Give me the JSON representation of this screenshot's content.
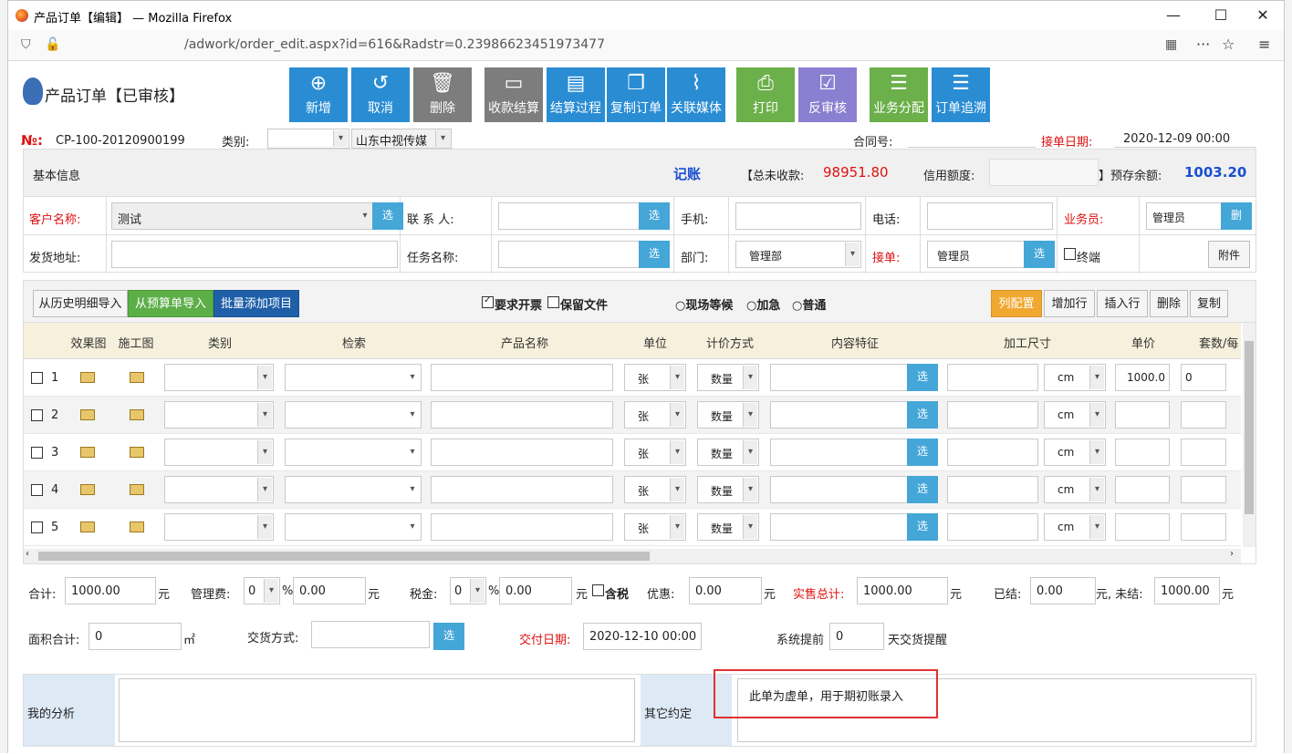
{
  "window": {
    "title": "产品订单【编辑】 — Mozilla Firefox",
    "url": "/adwork/order_edit.aspx?id=616&Radstr=0.23986623451973477"
  },
  "header": {
    "page_title": "产品订单【已审核】"
  },
  "toolbar": [
    {
      "label": "新增",
      "icon": "plus-circle-icon"
    },
    {
      "label": "取消",
      "icon": "undo-icon"
    },
    {
      "label": "删除",
      "icon": "trash-icon"
    },
    {
      "label": "收款结算",
      "icon": "money-icon"
    },
    {
      "label": "结算过程",
      "icon": "document-icon"
    },
    {
      "label": "复制订单",
      "icon": "copy-icon"
    },
    {
      "label": "关联媒体",
      "icon": "paperclip-icon"
    },
    {
      "label": "打印",
      "icon": "printer-icon"
    },
    {
      "label": "反审核",
      "icon": "check-square-icon"
    },
    {
      "label": "业务分配",
      "icon": "list-icon"
    },
    {
      "label": "订单追溯",
      "icon": "list-icon"
    }
  ],
  "order": {
    "no_label": "№:",
    "no": "CP-100-20120900199",
    "type_label": "类别:",
    "type_value": "",
    "company": "山东中视传媒",
    "contract_label": "合同号:",
    "contract_value": "",
    "order_date_label": "接单日期:",
    "order_date": "2020-12-09 00:00"
  },
  "info": {
    "title": "基本信息",
    "bookkeep": "记账",
    "unpaid_label": "【总未收款:",
    "unpaid": "98951.80",
    "credit_label": "信用额度:",
    "credit": "",
    "prepay_label": "】预存余额:",
    "prepay": "1003.20",
    "customer_label": "客户名称:",
    "customer": "测试",
    "contact_label": "联 系 人:",
    "contact": "",
    "mobile_label": "手机:",
    "mobile": "",
    "phone_label": "电话:",
    "phone": "",
    "salesman_label": "业务员:",
    "salesman": "管理员",
    "address_label": "发货地址:",
    "address": "",
    "task_label": "任务名称:",
    "task": "",
    "dept_label": "部门:",
    "dept": "管理部",
    "receiver_label": "接单:",
    "receiver": "管理员",
    "terminal_label": "终端",
    "attach_label": "附件",
    "pick": "选",
    "del": "删"
  },
  "items_bar": {
    "import_history": "从历史明细导入",
    "import_budget": "从预算单导入",
    "batch_add": "批量添加项目",
    "invoice": "要求开票",
    "keep_file": "保留文件",
    "wait": "现场等候",
    "urgent": "加急",
    "normal": "普通",
    "col_config": "列配置",
    "add_row": "增加行",
    "insert_row": "插入行",
    "delete": "删除",
    "copy": "复制"
  },
  "columns": [
    "效果图",
    "施工图",
    "类别",
    "检索",
    "产品名称",
    "单位",
    "计价方式",
    "内容特征",
    "加工尺寸",
    "单价",
    "套数/每"
  ],
  "rows": [
    {
      "n": "1",
      "unit": "张",
      "price_mode": "数量",
      "size_unit": "cm",
      "price": "1000.0",
      "sets": "0"
    },
    {
      "n": "2",
      "unit": "张",
      "price_mode": "数量",
      "size_unit": "cm",
      "price": "",
      "sets": ""
    },
    {
      "n": "3",
      "unit": "张",
      "price_mode": "数量",
      "size_unit": "cm",
      "price": "",
      "sets": ""
    },
    {
      "n": "4",
      "unit": "张",
      "price_mode": "数量",
      "size_unit": "cm",
      "price": "",
      "sets": ""
    },
    {
      "n": "5",
      "unit": "张",
      "price_mode": "数量",
      "size_unit": "cm",
      "price": "",
      "sets": ""
    }
  ],
  "totals": {
    "sum_label": "合计:",
    "sum": "1000.00",
    "yuan": "元",
    "mgmt_label": "管理费:",
    "mgmt_pct": "0",
    "mgmt": "0.00",
    "tax_label": "税金:",
    "tax_pct": "0",
    "tax": "0.00",
    "tax_incl": "含税",
    "discount_label": "优惠:",
    "discount": "0.00",
    "actual_label": "实售总计:",
    "actual": "1000.00",
    "settled_label": "已结:",
    "settled": "0.00",
    "unsettled_label": "元, 未结:",
    "unsettled": "1000.00",
    "area_label": "面积合计:",
    "area": "0",
    "area_unit": "㎡",
    "delivery_label": "交货方式:",
    "delivery": "",
    "deliver_date_label": "交付日期:",
    "deliver_date": "2020-12-10 00:00",
    "remind_label": "系统提前",
    "remind": "0",
    "remind_suffix": "天交货提醒"
  },
  "bottom": {
    "analysis_label": "我的分析",
    "analysis": "",
    "other_label": "其它约定",
    "other": "此单为虚单，用于期初账录入"
  }
}
